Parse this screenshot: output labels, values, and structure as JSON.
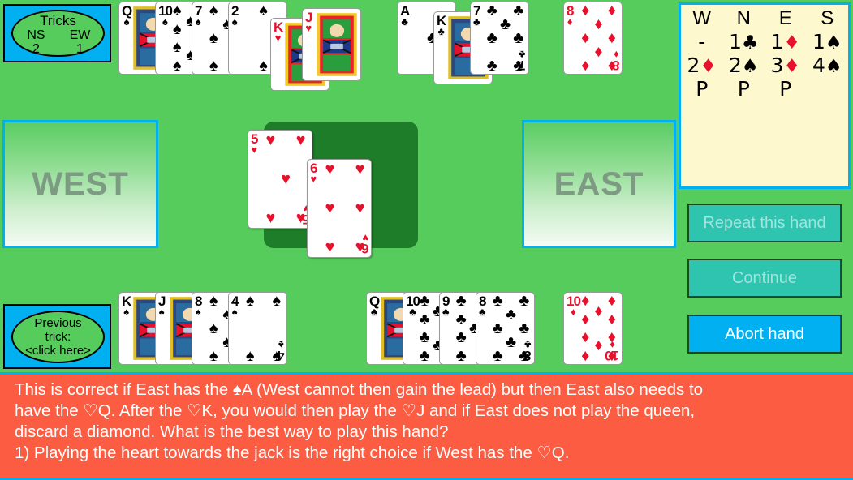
{
  "tricks": {
    "title": "Tricks",
    "ns_label": "NS",
    "ew_label": "EW",
    "ns_value": "2",
    "ew_value": "1"
  },
  "previous_trick": {
    "line1": "Previous",
    "line2": "trick:",
    "line3": "<click here>"
  },
  "seats": {
    "west": "WEST",
    "east": "EAST"
  },
  "bidding": {
    "headers": [
      "W",
      "N",
      "E",
      "S"
    ],
    "rows": [
      [
        {
          "rank": "-",
          "suit": ""
        },
        {
          "rank": "1",
          "suit": "♣"
        },
        {
          "rank": "1",
          "suit": "♦"
        },
        {
          "rank": "1",
          "suit": "♠"
        }
      ],
      [
        {
          "rank": "2",
          "suit": "♦"
        },
        {
          "rank": "2",
          "suit": "♠"
        },
        {
          "rank": "3",
          "suit": "♦"
        },
        {
          "rank": "4",
          "suit": "♠"
        }
      ],
      [
        {
          "rank": "P",
          "suit": ""
        },
        {
          "rank": "P",
          "suit": ""
        },
        {
          "rank": "P",
          "suit": ""
        },
        {
          "rank": "",
          "suit": ""
        }
      ]
    ]
  },
  "buttons": {
    "repeat": "Repeat this hand",
    "continue": "Continue",
    "abort": "Abort hand"
  },
  "north_hand": [
    {
      "rank": "Q",
      "suit": "♠",
      "color": "blk",
      "face": true
    },
    {
      "rank": "10",
      "suit": "♠",
      "color": "blk",
      "face": false
    },
    {
      "rank": "7",
      "suit": "♠",
      "color": "blk",
      "face": false
    },
    {
      "rank": "2",
      "suit": "♠",
      "color": "blk",
      "face": false
    },
    {
      "rank": "K",
      "suit": "♥",
      "color": "red",
      "face": true
    },
    {
      "rank": "J",
      "suit": "♥",
      "color": "red",
      "face": true
    },
    {
      "rank": "A",
      "suit": "♣",
      "color": "blk",
      "face": false
    },
    {
      "rank": "K",
      "suit": "♣",
      "color": "blk",
      "face": true
    },
    {
      "rank": "7",
      "suit": "♣",
      "color": "blk",
      "face": false
    },
    {
      "rank": "8",
      "suit": "♦",
      "color": "red",
      "face": false
    }
  ],
  "south_hand": [
    {
      "rank": "K",
      "suit": "♠",
      "color": "blk",
      "face": true
    },
    {
      "rank": "J",
      "suit": "♠",
      "color": "blk",
      "face": true
    },
    {
      "rank": "8",
      "suit": "♠",
      "color": "blk",
      "face": false
    },
    {
      "rank": "4",
      "suit": "♠",
      "color": "blk",
      "face": false
    },
    {
      "rank": "Q",
      "suit": "♣",
      "color": "blk",
      "face": true
    },
    {
      "rank": "10",
      "suit": "♣",
      "color": "blk",
      "face": false
    },
    {
      "rank": "9",
      "suit": "♣",
      "color": "blk",
      "face": false
    },
    {
      "rank": "8",
      "suit": "♣",
      "color": "blk",
      "face": false
    },
    {
      "rank": "10",
      "suit": "♦",
      "color": "red",
      "face": false
    }
  ],
  "trick_cards": [
    {
      "rank": "5",
      "suit": "♥",
      "color": "red"
    },
    {
      "rank": "6",
      "suit": "♥",
      "color": "red"
    }
  ],
  "message": {
    "line1": "This is correct if East has the ♠A (West cannot then gain the lead) but then East also needs to",
    "line2": "have the ♡Q. After the ♡K, you would then play the ♡J and if East does not play the queen,",
    "line3": "discard a diamond. What is the best way to play this hand?",
    "line4": "1) Playing the heart towards the jack is the right choice if West has the ♡Q."
  },
  "colors": {
    "table_green": "#55cc5c",
    "felt_green": "#1e7d28",
    "cyan": "#00b0f0",
    "bidding_bg": "#fdf8cd",
    "message_bg": "#fc5d42",
    "disabled_btn": "#2ec4b0",
    "red_suit": "#e8112d"
  }
}
